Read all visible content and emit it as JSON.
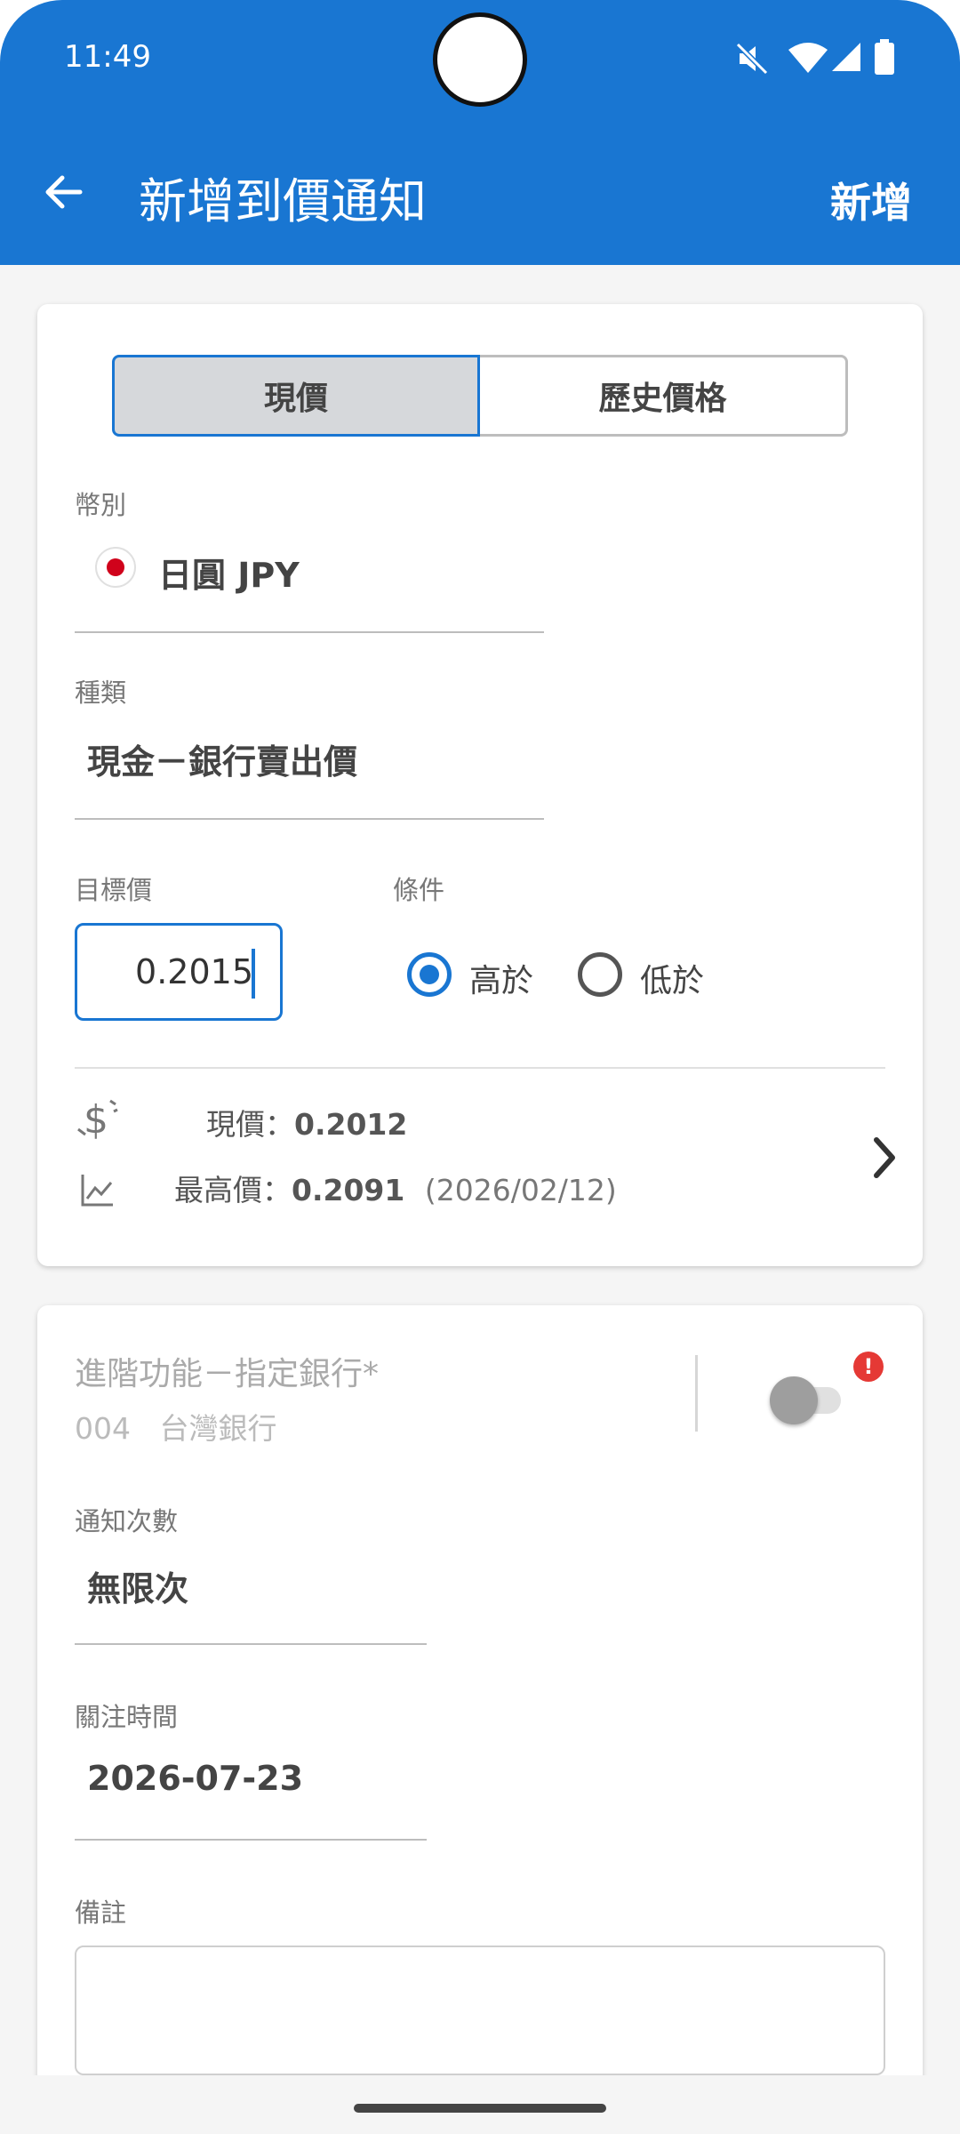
{
  "status_bar": {
    "time": "11:49"
  },
  "app_bar": {
    "title": "新增到價通知",
    "action_label": "新增"
  },
  "tabs": [
    {
      "label": "現價",
      "selected": true
    },
    {
      "label": "歷史價格",
      "selected": false
    }
  ],
  "currency": {
    "label": "幣別",
    "value": "日圓 JPY",
    "flag_icon": "japan-flag-icon"
  },
  "type": {
    "label": "種類",
    "value": "現金－銀行賣出價"
  },
  "target_price": {
    "label": "目標價",
    "value": "0.2015"
  },
  "condition": {
    "label": "條件",
    "options": [
      {
        "label": "高於",
        "selected": true
      },
      {
        "label": "低於",
        "selected": false
      }
    ]
  },
  "price_info": {
    "current_label": "現價：",
    "current_value": "0.2012",
    "high_label": "最高價：",
    "high_value": "0.2091",
    "high_date": "(2026/02/12)"
  },
  "advanced": {
    "title": "進階功能－指定銀行*",
    "bank_code": "004",
    "bank_name": "台灣銀行",
    "enabled": false,
    "badge": "!"
  },
  "notify_count": {
    "label": "通知次數",
    "value": "無限次"
  },
  "watch_time": {
    "label": "關注時間",
    "value": "2026-07-23"
  },
  "note": {
    "label": "備註",
    "value": ""
  },
  "colors": {
    "primary": "#1976d2",
    "badge": "#e53935"
  }
}
